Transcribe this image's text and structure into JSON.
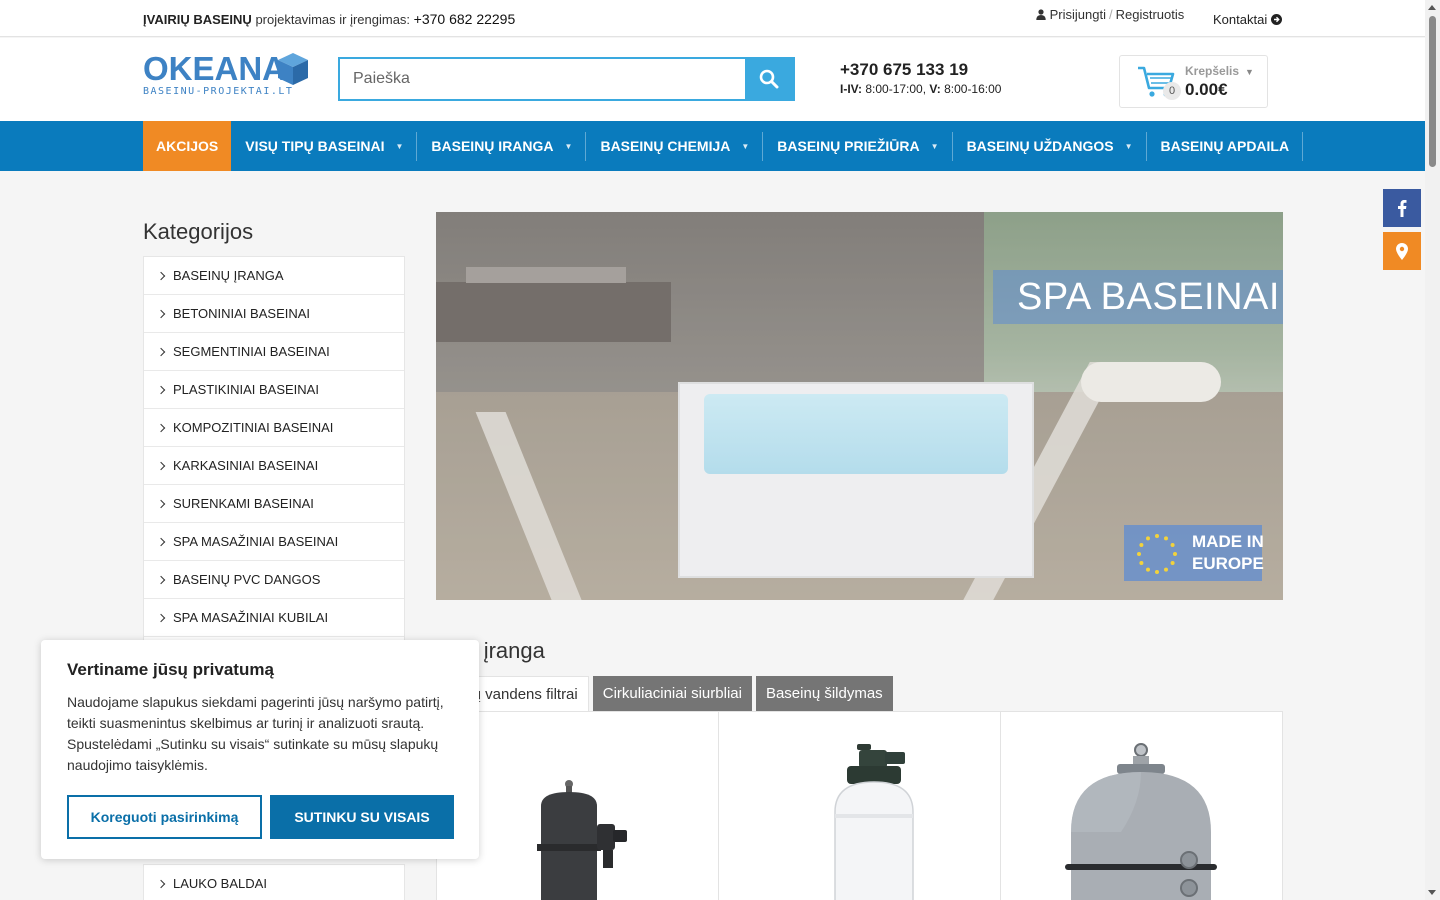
{
  "topbar": {
    "brand_bold": "ĮVAIRIŲ BASEINŲ",
    "tagline": " projektavimas ir įrengimas: ",
    "phone": "+370 682 22295",
    "login": "Prisijungti",
    "separator": "/",
    "register": "Registruotis",
    "contacts": "Kontaktai"
  },
  "header": {
    "logo_word": "OKEANA",
    "logo_sub": "BASEINU-PROJEKTAI.LT",
    "search_placeholder": "Paieška",
    "phone": "+370 675 133 19",
    "hours_days1": "I-IV:",
    "hours_time1": " 8:00-17:00, ",
    "hours_days2": "V:",
    "hours_time2": " 8:00-16:00",
    "cart_label": "Krepšelis",
    "cart_count": "0",
    "cart_total": "0.00€"
  },
  "nav": {
    "items": [
      {
        "label": "AKCIJOS"
      },
      {
        "label": "VISŲ TIPŲ BASEINAI"
      },
      {
        "label": "BASEINŲ IRANGA"
      },
      {
        "label": "BASEINŲ CHEMIJA"
      },
      {
        "label": "BASEINŲ PRIEŽIŪRA"
      },
      {
        "label": "BASEINŲ UŽDANGOS"
      },
      {
        "label": "BASEINŲ APDAILA"
      }
    ],
    "accent_color": "#f08a24",
    "bar_color": "#0a7bbd"
  },
  "sidebar": {
    "title": "Kategorijos",
    "items": [
      {
        "label": "BASEINŲ ĮRANGA"
      },
      {
        "label": "BETONINIAI BASEINAI"
      },
      {
        "label": "SEGMENTINIAI BASEINAI"
      },
      {
        "label": "PLASTIKINIAI BASEINAI"
      },
      {
        "label": "KOMPOZITINIAI BASEINAI"
      },
      {
        "label": "KARKASINIAI BASEINAI"
      },
      {
        "label": "SURENKAMI BASEINAI"
      },
      {
        "label": "SPA MASAŽINIAI BASEINAI"
      },
      {
        "label": "BASEINŲ PVC DANGOS"
      },
      {
        "label": "SPA MASAŽINIAI KUBILAI"
      }
    ],
    "bottom_item": "LAUKO BALDAI"
  },
  "banner": {
    "title": "SPA BASEINAI",
    "badge_line1": "MADE IN",
    "badge_line2": "EUROPE"
  },
  "section": {
    "title": "einų įranga",
    "tabs": [
      {
        "label": "inų vandens filtrai"
      },
      {
        "label": "Cirkuliaciniai siurbliai"
      },
      {
        "label": "Baseinų šildymas"
      }
    ]
  },
  "cookie": {
    "title": "Vertiname jūsų privatumą",
    "text": "Naudojame slapukus siekdami pagerinti jūsų naršymo patirtį, teikti suasmenintus skelbimus ar turinį ir analizuoti srautą. Spustelėdami „Sutinku su visais“ sutinkate su mūsų slapukų naudojimo taisyklėmis.",
    "customize": "Koreguoti pasirinkimą",
    "accept": "SUTINKU SU VISAIS"
  },
  "icons": {
    "user": "user-icon",
    "contact_arrow": "arrow-circle-right-icon",
    "search": "search-icon",
    "cart": "cart-icon",
    "facebook": "facebook-icon",
    "location": "map-marker-icon"
  }
}
